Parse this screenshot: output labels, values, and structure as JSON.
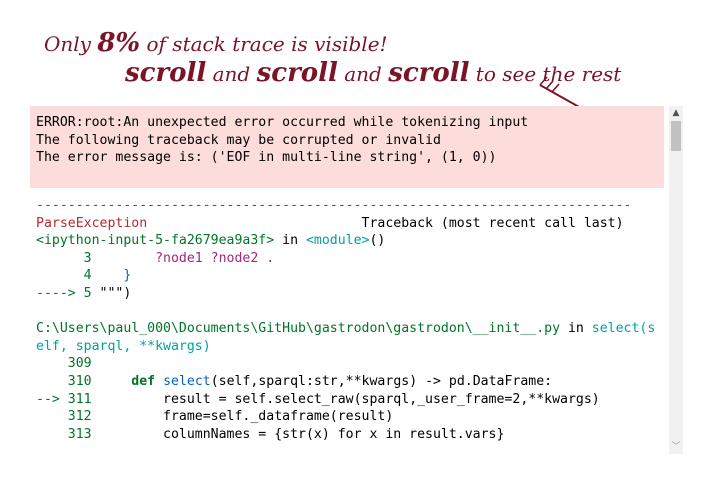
{
  "annotation": {
    "line1_a": "Only ",
    "line1_b": "8%",
    "line1_c": " of stack trace is visible!",
    "line2_a": "scroll",
    "line2_b": " and ",
    "line2_c": "scroll",
    "line2_d": " and ",
    "line2_e": "scroll",
    "line2_f": " to see the rest",
    "color": "#7a1428"
  },
  "stderr": {
    "background": "#fddcdc",
    "line1": "ERROR:root:An unexpected error occurred while tokenizing input",
    "line2": "The following traceback may be corrupted or invalid",
    "line3": "The error message is: ('EOF in multi-line string', (1, 0))"
  },
  "traceback": {
    "separator": "---------------------------------------------------------------------------",
    "exception_name": "ParseException",
    "header_right": "Traceback (most recent call last)",
    "frame1": {
      "input_ref": "<ipython-input-5-fa2679ea9a3f>",
      "in": " in ",
      "module": "<module>",
      "paren": "()",
      "l3_num": "      3",
      "l3_code": "        ?node1 ?node2 .",
      "l4_num": "      4",
      "l4_code": "    }",
      "arrow5": "----> 5",
      "l5_code": " \"\"\")"
    },
    "frame2": {
      "path": "C:\\Users\\paul_000\\Documents\\GitHub\\gastrodon\\gastrodon\\__init__.py",
      "in": " in ",
      "func_a": "select(s",
      "func_b": "elf, sparql, **kwargs)",
      "l309": "    309",
      "l310": "    310",
      "l310_indent": "     ",
      "l310_def": "def",
      "l310_sp": " ",
      "l310_name": "select",
      "l310_rest": "(self,sparql:str,**kwargs) -> pd.DataFrame:",
      "arrow311": "--> 311",
      "l311_code": "         result = self.select_raw(sparql,_user_frame=2,**kwargs)",
      "l312": "    312",
      "l312_code": "         frame=self._dataframe(result)",
      "l313": "    313",
      "l313_code": "         columnNames = {str(x) for x in result.vars}"
    }
  },
  "scrollbar": {
    "up_icon": "▲",
    "down_icon": "﹀",
    "position_fraction": 0.08
  }
}
